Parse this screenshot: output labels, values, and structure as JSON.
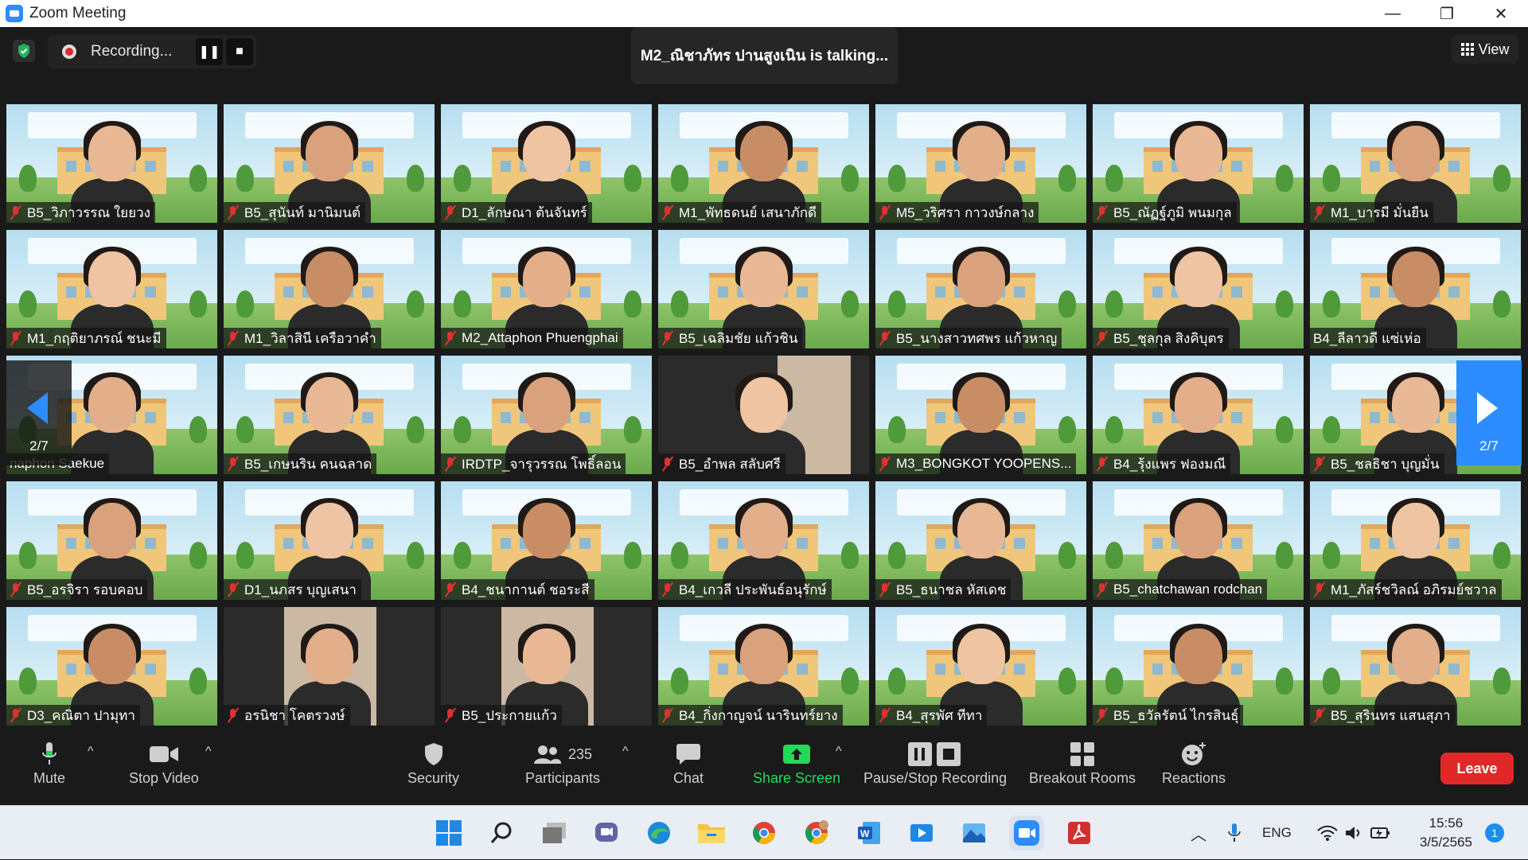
{
  "window": {
    "title": "Zoom Meeting",
    "minimize": "—",
    "maximize": "❐",
    "close": "✕"
  },
  "recording": {
    "label": "Recording...",
    "pause_icon": "❚❚",
    "stop_icon": "■"
  },
  "talking": "M2_ณิชาภัทร ปานสูงเนิน is talking...",
  "view": {
    "label": "View"
  },
  "pager": {
    "left": "2/7",
    "right": "2/7"
  },
  "participants": [
    {
      "name": "B5_วิภาวรรณ ใยยวง",
      "muted": true
    },
    {
      "name": "B5_สุนันท์ มานิมนต์",
      "muted": true
    },
    {
      "name": "D1_ลักษณา ต้นจันทร์",
      "muted": true
    },
    {
      "name": "M1_พัทธดนย์ เสนาภักดี",
      "muted": true
    },
    {
      "name": "M5_วริศรา กาวงษ์กลาง",
      "muted": true
    },
    {
      "name": "B5_ณัฏฐ์ภูมิ พนมกุล",
      "muted": true
    },
    {
      "name": "M1_บารมี มั่นยืน",
      "muted": true
    },
    {
      "name": "M1_กฤติยาภรณ์ ชนะมี",
      "muted": true
    },
    {
      "name": "M1_วิลาสินี เครือวาคำ",
      "muted": true
    },
    {
      "name": "M2_Attaphon Phuengphai",
      "muted": true
    },
    {
      "name": "B5_เฉลิมชัย แก้วชิน",
      "muted": true
    },
    {
      "name": "B5_นางสาวทศพร แก้วหาญ",
      "muted": true
    },
    {
      "name": "B5_ชุลกุล สิงคิบุตร",
      "muted": true
    },
    {
      "name": "B4_ลีลาวดี แซ่เห่อ",
      "muted": false
    },
    {
      "name": "naphon Saekue",
      "muted": false
    },
    {
      "name": "B5_เกษนริน คนฉลาด",
      "muted": true
    },
    {
      "name": "IRDTP_จารุวรรณ โพธิ์ลอน",
      "muted": true
    },
    {
      "name": "B5_อำพล สลับศรี",
      "muted": true
    },
    {
      "name": "M3_BONGKOT YOOPENS...",
      "muted": true
    },
    {
      "name": "B4_รุ้งแพร ฟองมณี",
      "muted": true
    },
    {
      "name": "B5_ชลธิชา บุญมั่น",
      "muted": true
    },
    {
      "name": "B5_อรจิรา รอบคอบ",
      "muted": true
    },
    {
      "name": "D1_นภสร บุญเสนา",
      "muted": true
    },
    {
      "name": "B4_ชนากานต์ ชอระสี",
      "muted": true
    },
    {
      "name": "B4_เกวลี ประพันธ์อนุรักษ์",
      "muted": true
    },
    {
      "name": "B5_ธนาชล หัสเดช",
      "muted": true
    },
    {
      "name": "B5_chatchawan rodchan",
      "muted": true
    },
    {
      "name": "M1_ภัสร์ชวิลณ์ อภิรมย์ชวาล",
      "muted": true
    },
    {
      "name": "D3_คณิตา ปามุทา",
      "muted": true
    },
    {
      "name": "อรนิชา โคตรวงษ์",
      "muted": true
    },
    {
      "name": "B5_ประกายแก้ว",
      "muted": true
    },
    {
      "name": "B4_กิ่งกาญจน์ นารินทร์ยาง",
      "muted": true
    },
    {
      "name": "B4_สุรพัศ ทีทา",
      "muted": true
    },
    {
      "name": "B5_ธวัลรัตน์ ไกรสินธุ์",
      "muted": true
    },
    {
      "name": "B5_สุรินทร แสนสุภา",
      "muted": true
    }
  ],
  "toolbar": {
    "mute": "Mute",
    "stop_video": "Stop Video",
    "security": "Security",
    "participants": "Participants",
    "participant_count": "235",
    "chat": "Chat",
    "share_screen": "Share Screen",
    "pause_stop_recording": "Pause/Stop Recording",
    "breakout_rooms": "Breakout Rooms",
    "reactions": "Reactions",
    "leave": "Leave",
    "colors": {
      "share": "#23d959",
      "leave": "#e02828",
      "accent": "#2d8cff"
    }
  },
  "taskbar": {
    "apps": [
      "windows-start-icon",
      "search-icon",
      "task-view-icon",
      "teams-chat-icon",
      "edge-icon",
      "file-explorer-icon",
      "chrome-icon",
      "chrome-profile-icon",
      "word-icon",
      "media-player-icon",
      "photos-icon",
      "zoom-icon",
      "acrobat-icon"
    ],
    "language": "ENG",
    "time": "15:56",
    "date": "3/5/2565",
    "notifications": "1"
  }
}
